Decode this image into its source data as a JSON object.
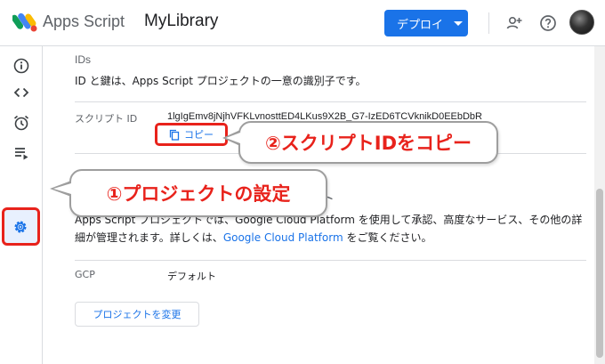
{
  "header": {
    "app_name": "Apps Script",
    "project_name": "MyLibrary",
    "deploy_label": "デプロイ",
    "icons": [
      "apps-script-logo",
      "add-person-icon",
      "help-icon",
      "avatar"
    ]
  },
  "sidebar": {
    "items": [
      {
        "icon": "info-icon",
        "active": false
      },
      {
        "icon": "code-icon",
        "active": false
      },
      {
        "icon": "alarm-icon",
        "active": false
      },
      {
        "icon": "executions-icon",
        "active": false
      },
      {
        "icon": "settings-icon",
        "active": true
      }
    ]
  },
  "ids_section": {
    "title": "IDs",
    "description": "ID と鍵は、Apps Script プロジェクトの一意の識別子です。",
    "script_id_label": "スクリプト ID",
    "script_id_value": "1lgIgEmv8jNjhVFKLvnosttED4LKus9X2B_G7-IzED6TCVknikD0EEbDbR",
    "copy_label": "コピー"
  },
  "gcp_section": {
    "partial_heading": "ト",
    "desc_part1": "Apps Script プロジェクトでは、Google Cloud Platform を使用して承認、高度なサービス、その他の詳細が管理されます。詳しくは、",
    "link_text": "Google Cloud Platform",
    "desc_part2": " をご覧ください。",
    "gcp_label": "GCP",
    "gcp_value": "デフォルト",
    "change_button": "プロジェクトを変更"
  },
  "annotations": {
    "callout_1": "①プロジェクトの設定",
    "callout_2": "②スクリプトIDをコピー",
    "highlight_color": "#e8221b"
  },
  "colors": {
    "accent": "#1a73e8",
    "annotation": "#e8221b"
  }
}
